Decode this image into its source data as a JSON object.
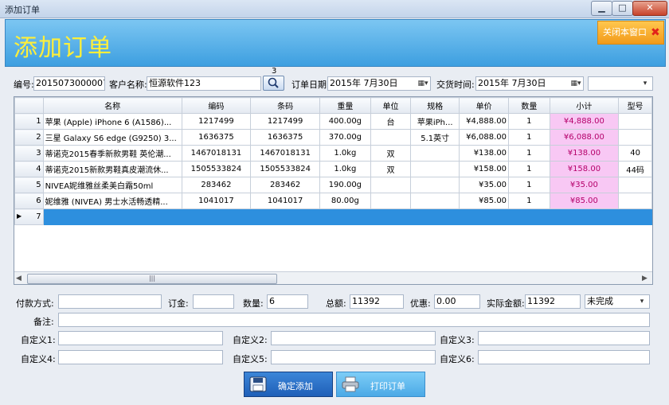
{
  "window": {
    "title": "添加订单"
  },
  "header": {
    "title": "添加订单",
    "close_label": "关闭本窗口"
  },
  "form": {
    "code_label": "编号:",
    "code_value": "2015073000007",
    "customer_label": "客户名称:",
    "customer_value": "恒源软件123",
    "badge": "3",
    "order_date_label": "订单日期:",
    "order_date_value": "2015年 7月30日",
    "deal_time_label": "交货时间:",
    "deal_time_value": "2015年 7月30日",
    "extra_select_value": ""
  },
  "grid": {
    "columns": [
      "名称",
      "编码",
      "条码",
      "重量",
      "单位",
      "规格",
      "单价",
      "数量",
      "小计",
      "型号"
    ],
    "rows": [
      {
        "n": "1",
        "name": "苹果 (Apple) iPhone 6 (A1586)...",
        "code": "1217499",
        "barcode": "1217499",
        "weight": "400.00g",
        "unit": "台",
        "spec": "苹果iPh...",
        "price": "¥4,888.00",
        "qty": "1",
        "subtotal": "¥4,888.00",
        "model": ""
      },
      {
        "n": "2",
        "name": "三星 Galaxy S6 edge (G9250) 3...",
        "code": "1636375",
        "barcode": "1636375",
        "weight": "370.00g",
        "unit": "",
        "spec": "5.1英寸",
        "price": "¥6,088.00",
        "qty": "1",
        "subtotal": "¥6,088.00",
        "model": ""
      },
      {
        "n": "3",
        "name": "蒂诺克2015春季新款男鞋 英伦潮...",
        "code": "1467018131",
        "barcode": "1467018131",
        "weight": "1.0kg",
        "unit": "双",
        "spec": "",
        "price": "¥138.00",
        "qty": "1",
        "subtotal": "¥138.00",
        "model": "40"
      },
      {
        "n": "4",
        "name": "蒂诺克2015新款男鞋真皮潮流休...",
        "code": "1505533824",
        "barcode": "1505533824",
        "weight": "1.0kg",
        "unit": "双",
        "spec": "",
        "price": "¥158.00",
        "qty": "1",
        "subtotal": "¥158.00",
        "model": "44码"
      },
      {
        "n": "5",
        "name": "NIVEA妮维雅丝柔美白霜50ml",
        "code": "283462",
        "barcode": "283462",
        "weight": "190.00g",
        "unit": "",
        "spec": "",
        "price": "¥35.00",
        "qty": "1",
        "subtotal": "¥35.00",
        "model": ""
      },
      {
        "n": "6",
        "name": "妮维雅 (NIVEA) 男士水活畅透精...",
        "code": "1041017",
        "barcode": "1041017",
        "weight": "80.00g",
        "unit": "",
        "spec": "",
        "price": "¥85.00",
        "qty": "1",
        "subtotal": "¥85.00",
        "model": ""
      }
    ],
    "new_row_number": "7",
    "new_row_marker": "▶",
    "scroll_thumb_glyph": "|||"
  },
  "summary": {
    "payment_label": "付款方式:",
    "payment_value": "",
    "deposit_label": "订金:",
    "deposit_value": "",
    "qty_label": "数量:",
    "qty_value": "6",
    "total_label": "总额:",
    "total_value": "11392",
    "discount_label": "优惠:",
    "discount_value": "0.00",
    "actual_label": "实际金额:",
    "actual_value": "11392",
    "status_value": "未完成",
    "note_label": "备注:",
    "note_value": "",
    "custom": [
      {
        "label": "自定义1:",
        "value": ""
      },
      {
        "label": "自定义2:",
        "value": ""
      },
      {
        "label": "自定义3:",
        "value": ""
      },
      {
        "label": "自定义4:",
        "value": ""
      },
      {
        "label": "自定义5:",
        "value": ""
      },
      {
        "label": "自定义6:",
        "value": ""
      }
    ]
  },
  "buttons": {
    "confirm_label": "确定添加",
    "print_label": "打印订单"
  },
  "colors": {
    "header_bg": "#3d9fe0",
    "title_text": "#ffef3a",
    "subtotal_bg": "#f8c8f4",
    "selected_row": "#2d8fde"
  }
}
